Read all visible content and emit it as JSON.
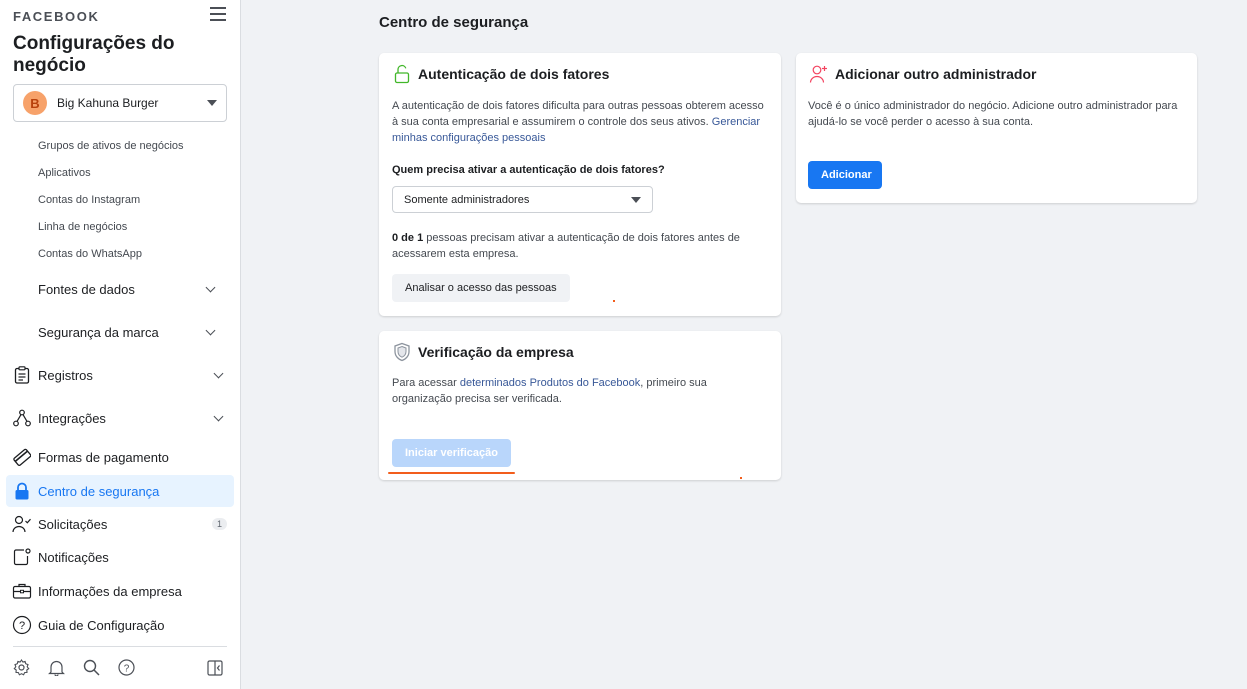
{
  "sidebar": {
    "brand": "FACEBOOK",
    "title": "Configurações do negócio",
    "account": {
      "initial": "B",
      "name": "Big Kahuna Burger"
    },
    "sub_items": [
      {
        "label": "Grupos de ativos de negócios"
      },
      {
        "label": "Aplicativos"
      },
      {
        "label": "Contas do Instagram"
      },
      {
        "label": "Linha de negócios"
      },
      {
        "label": "Contas do WhatsApp"
      }
    ],
    "groups": [
      {
        "label": "Fontes de dados"
      },
      {
        "label": "Segurança da marca"
      }
    ],
    "nav": [
      {
        "label": "Registros",
        "icon": "clipboard-icon"
      },
      {
        "label": "Integrações",
        "icon": "integrations-icon"
      },
      {
        "label": "Formas de pagamento",
        "icon": "credit-card-icon"
      },
      {
        "label": "Centro de segurança",
        "icon": "lock-icon",
        "active": true
      },
      {
        "label": "Solicitações",
        "icon": "person-check-icon",
        "badge": "1"
      },
      {
        "label": "Notificações",
        "icon": "notification-icon"
      },
      {
        "label": "Informações da empresa",
        "icon": "briefcase-icon"
      },
      {
        "label": "Guia de Configuração",
        "icon": "help-icon"
      }
    ],
    "bottom_icons": [
      "gear-icon",
      "bell-icon",
      "search-icon",
      "help-icon",
      "panel-toggle-icon"
    ]
  },
  "main": {
    "title": "Centro de segurança",
    "two_factor": {
      "title": "Autenticação de dois fatores",
      "description": "A autenticação de dois fatores dificulta para outras pessoas obterem acesso à sua conta empresarial e assumirem o controle dos seus ativos.",
      "link": "Gerenciar minhas configurações pessoais",
      "question": "Quem precisa ativar a autenticação de dois fatores?",
      "selected_option": "Somente administradores",
      "count_strong": "0 de 1",
      "count_text": " pessoas precisam ativar a autenticação de dois fatores antes de acessarem esta empresa.",
      "button": "Analisar o acesso das pessoas"
    },
    "verification": {
      "title": "Verificação da empresa",
      "text_before": "Para acessar ",
      "link": "determinados Produtos do Facebook",
      "text_after": ", primeiro sua organização precisa ser verificada.",
      "button": "Iniciar verificação"
    },
    "add_admin": {
      "title": "Adicionar outro administrador",
      "description": "Você é o único administrador do negócio. Adicione outro administrador para ajudá-lo se você perder o acesso à sua conta.",
      "button": "Adicionar"
    }
  },
  "colors": {
    "accent": "#1877f2",
    "active_bg": "#e7f3ff",
    "avatar_bg": "#f7a26a",
    "annotation": "#f25d1c"
  }
}
